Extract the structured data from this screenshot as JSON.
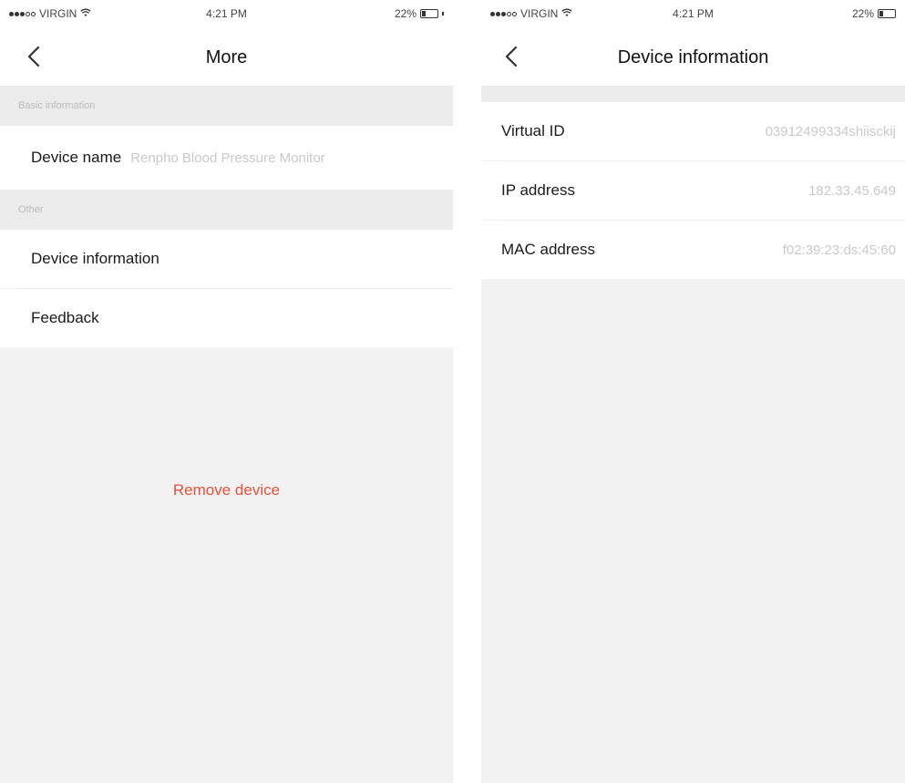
{
  "status_bar": {
    "carrier": "VIRGIN",
    "time": "4:21 PM",
    "battery": "22%",
    "battery_level": 0.22
  },
  "left_screen": {
    "title": "More",
    "section_basic": "Basic information",
    "device_name_label": "Device name",
    "device_name_value": "Renpho Blood Pressure Monitor",
    "section_other": "Other",
    "device_information_label": "Device information",
    "feedback_label": "Feedback",
    "remove_device_label": "Remove device"
  },
  "right_screen": {
    "title": "Device information",
    "rows": [
      {
        "label": "Virtual ID",
        "value": "03912499334shiisckij"
      },
      {
        "label": "IP address",
        "value": "182.33.45.649"
      },
      {
        "label": "MAC address",
        "value": "f02:39:23:ds:45:60"
      }
    ]
  },
  "colors": {
    "accent_red": "#e8503a",
    "background": "#f2f2f2",
    "placeholder_gray": "#c9c9c9"
  },
  "icons": [
    "back-chevron-icon",
    "wifi-icon",
    "battery-icon",
    "signal-dots-icon"
  ]
}
